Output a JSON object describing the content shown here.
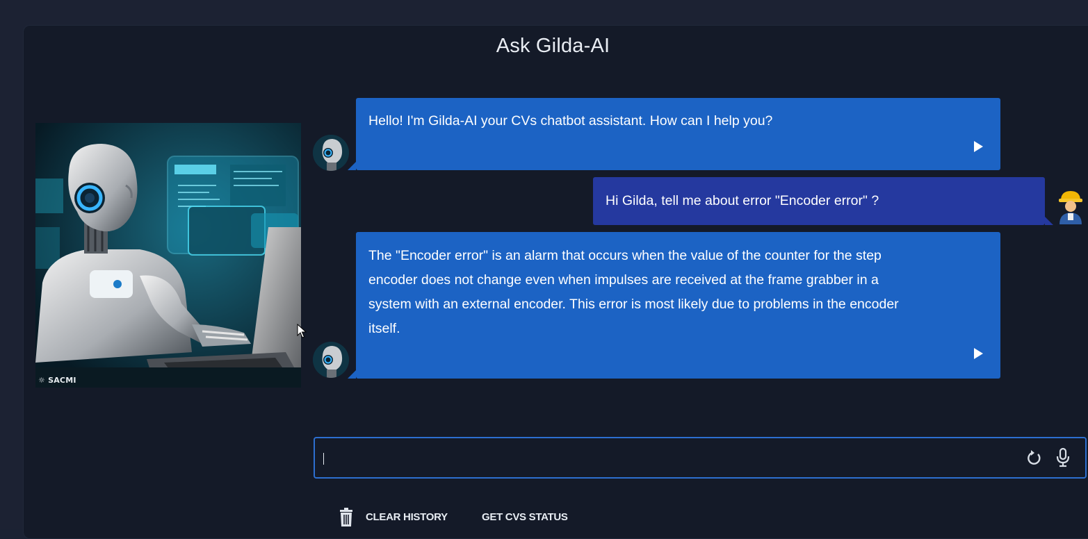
{
  "header": {
    "title": "Ask Gilda-AI"
  },
  "hero": {
    "watermark": "SACMI",
    "icon": "robot-illustration"
  },
  "messages": [
    {
      "role": "bot",
      "text": "Hello! I'm Gilda-AI your CVs chatbot assistant. How can I help you?",
      "icon": "play-icon"
    },
    {
      "role": "user",
      "text": "Hi Gilda, tell me about error \"Encoder error\" ?"
    },
    {
      "role": "bot",
      "lines": [
        "The \"Encoder error\" is an alarm that occurs when the value of the counter for the step",
        "encoder does not change even when impulses are received at the frame grabber in a",
        "system with an external encoder. This error is most likely due to problems in the encoder",
        "itself."
      ],
      "icon": "play-icon"
    }
  ],
  "input": {
    "value": "",
    "placeholder": "",
    "icons": [
      "refresh-icon",
      "microphone-icon"
    ]
  },
  "actions": {
    "clear_history": "CLEAR HISTORY",
    "get_cvs_status": "GET CVS STATUS",
    "clear_icon": "trash-icon"
  },
  "colors": {
    "background": "#1c2233",
    "panel": "#141a28",
    "bot_bubble": "#1c63c4",
    "user_bubble": "#25399f",
    "input_border": "#2d6fd0"
  }
}
